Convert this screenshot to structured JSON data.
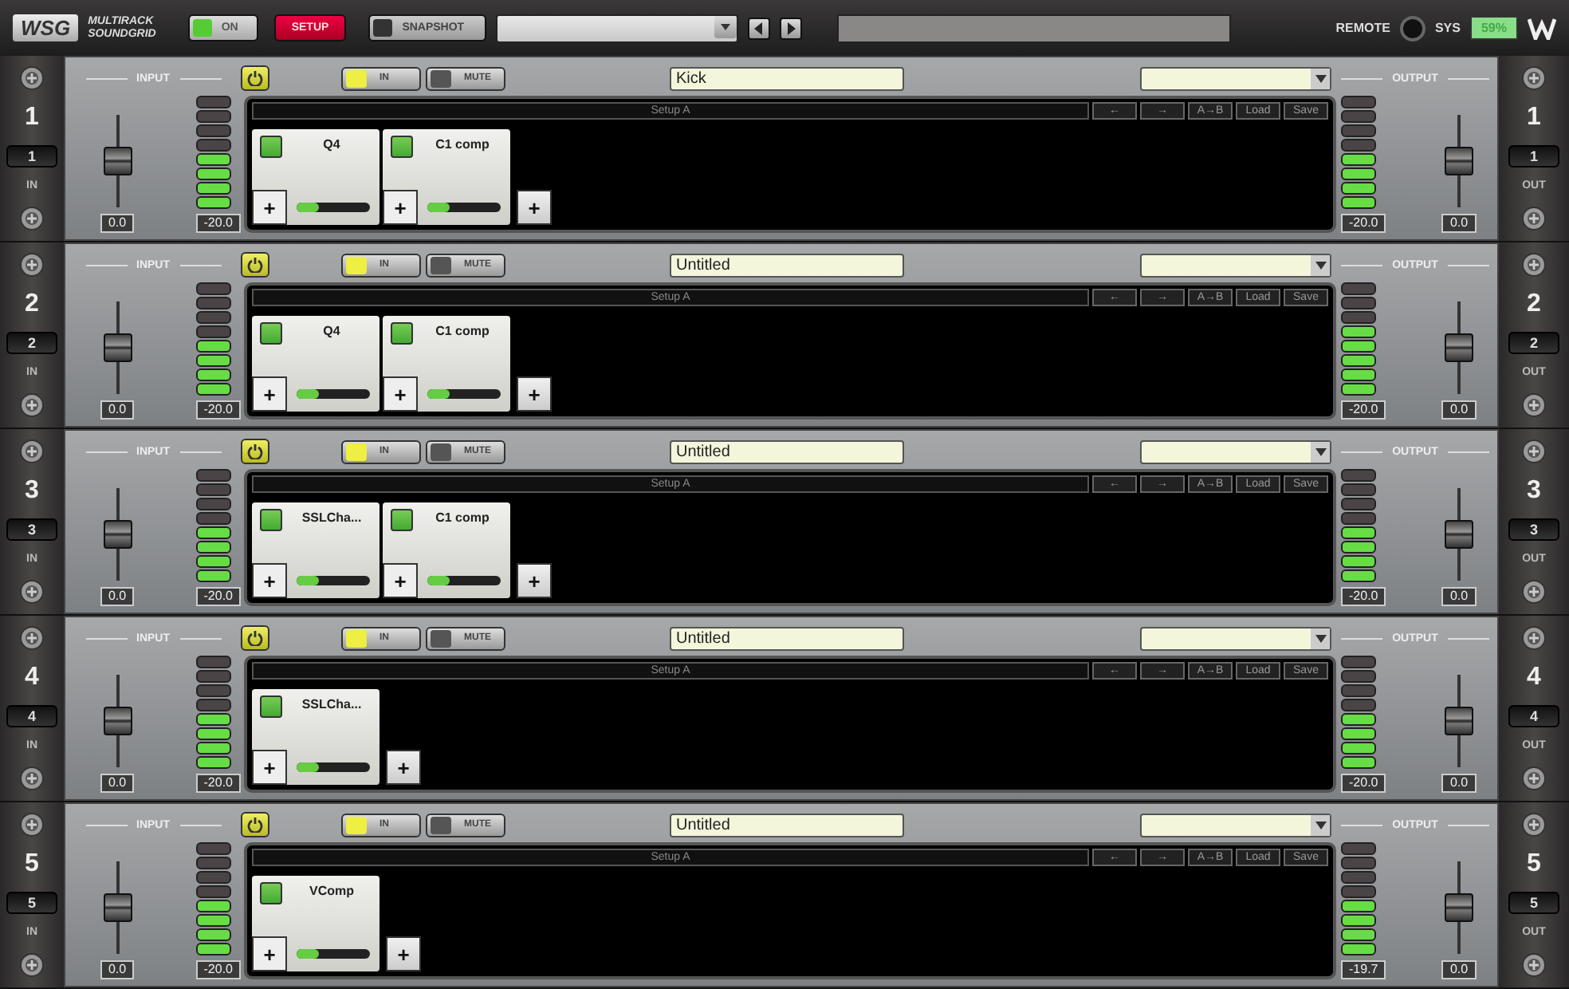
{
  "top_bar": {
    "logo": "WSG",
    "product": [
      "MULTIRACK",
      "SOUNDGRID"
    ],
    "on_button": {
      "label": "ON",
      "on": true
    },
    "setup_button": "SETUP",
    "snapshot_button": "SNAPSHOT",
    "remote_label": "REMOTE",
    "sys_label": "SYS",
    "sys_reading": "59%"
  },
  "racks": [
    {
      "number": "1",
      "badge": "1",
      "in_label": "IN",
      "out_number": "1",
      "out_badge": "1",
      "out_label": "OUT",
      "input_label": "INPUT",
      "output_label": "OUTPUT",
      "power_on": true,
      "in_button": {
        "label": "IN",
        "on": true
      },
      "mute_button": {
        "label": "MUTE",
        "on": false
      },
      "name": "Kick",
      "input_fader": {
        "level": 0.5,
        "reading": "0.0"
      },
      "input_meter": {
        "level": 0.5,
        "reading": "-20.0"
      },
      "setup": "Setup A",
      "chain_buttons": [
        "←",
        "→",
        "A→B",
        "Load",
        "Save"
      ],
      "plugins": [
        {
          "name": "Q4",
          "on": true,
          "level": 0.3,
          "add": "+"
        },
        {
          "name": "C1 comp",
          "on": true,
          "level": 0.3,
          "add": "+"
        }
      ],
      "add_button": "+",
      "output_meter": {
        "level": 0.5,
        "reading": "-20.0"
      },
      "output_fader": {
        "level": 0.5,
        "reading": "0.0"
      }
    },
    {
      "number": "2",
      "badge": "2",
      "in_label": "IN",
      "out_number": "2",
      "out_badge": "2",
      "out_label": "OUT",
      "input_label": "INPUT",
      "output_label": "OUTPUT",
      "power_on": true,
      "in_button": {
        "label": "IN",
        "on": true
      },
      "mute_button": {
        "label": "MUTE",
        "on": false
      },
      "name": "Untitled",
      "input_fader": {
        "level": 0.5,
        "reading": "0.0"
      },
      "input_meter": {
        "level": 0.5,
        "reading": "-20.0"
      },
      "setup": "Setup A",
      "chain_buttons": [
        "←",
        "→",
        "A→B",
        "Load",
        "Save"
      ],
      "plugins": [
        {
          "name": "Q4",
          "on": true,
          "level": 0.3,
          "add": "+"
        },
        {
          "name": "C1 comp",
          "on": true,
          "level": 0.3,
          "add": "+"
        }
      ],
      "add_button": "+",
      "output_meter": {
        "level": 0.625,
        "reading": "-20.0"
      },
      "output_fader": {
        "level": 0.5,
        "reading": "0.0"
      }
    },
    {
      "number": "3",
      "badge": "3",
      "in_label": "IN",
      "out_number": "3",
      "out_badge": "3",
      "out_label": "OUT",
      "input_label": "INPUT",
      "output_label": "OUTPUT",
      "power_on": true,
      "in_button": {
        "label": "IN",
        "on": true
      },
      "mute_button": {
        "label": "MUTE",
        "on": false
      },
      "name": "Untitled",
      "input_fader": {
        "level": 0.5,
        "reading": "0.0"
      },
      "input_meter": {
        "level": 0.5,
        "reading": "-20.0"
      },
      "setup": "Setup A",
      "chain_buttons": [
        "←",
        "→",
        "A→B",
        "Load",
        "Save"
      ],
      "plugins": [
        {
          "name": "SSLCha...",
          "on": true,
          "level": 0.3,
          "add": "+"
        },
        {
          "name": "C1 comp",
          "on": true,
          "level": 0.3,
          "add": "+"
        }
      ],
      "add_button": "+",
      "output_meter": {
        "level": 0.5,
        "reading": "-20.0"
      },
      "output_fader": {
        "level": 0.5,
        "reading": "0.0"
      }
    },
    {
      "number": "4",
      "badge": "4",
      "in_label": "IN",
      "out_number": "4",
      "out_badge": "4",
      "out_label": "OUT",
      "input_label": "INPUT",
      "output_label": "OUTPUT",
      "power_on": true,
      "in_button": {
        "label": "IN",
        "on": true
      },
      "mute_button": {
        "label": "MUTE",
        "on": false
      },
      "name": "Untitled",
      "input_fader": {
        "level": 0.5,
        "reading": "0.0"
      },
      "input_meter": {
        "level": 0.5,
        "reading": "-20.0"
      },
      "setup": "Setup A",
      "chain_buttons": [
        "←",
        "→",
        "A→B",
        "Load",
        "Save"
      ],
      "plugins": [
        {
          "name": "SSLCha...",
          "on": true,
          "level": 0.3,
          "add": "+"
        }
      ],
      "add_button": "+",
      "output_meter": {
        "level": 0.5,
        "reading": "-20.0"
      },
      "output_fader": {
        "level": 0.5,
        "reading": "0.0"
      }
    },
    {
      "number": "5",
      "badge": "5",
      "in_label": "IN",
      "out_number": "5",
      "out_badge": "5",
      "out_label": "OUT",
      "input_label": "INPUT",
      "output_label": "OUTPUT",
      "power_on": true,
      "in_button": {
        "label": "IN",
        "on": true
      },
      "mute_button": {
        "label": "MUTE",
        "on": false
      },
      "name": "Untitled",
      "input_fader": {
        "level": 0.5,
        "reading": "0.0"
      },
      "input_meter": {
        "level": 0.5,
        "reading": "-20.0"
      },
      "setup": "Setup A",
      "chain_buttons": [
        "←",
        "→",
        "A→B",
        "Load",
        "Save"
      ],
      "plugins": [
        {
          "name": "VComp",
          "on": true,
          "level": 0.3,
          "add": "+"
        }
      ],
      "add_button": "+",
      "output_meter": {
        "level": 0.5,
        "reading": "-19.7"
      },
      "output_fader": {
        "level": 0.5,
        "reading": "0.0"
      }
    }
  ]
}
